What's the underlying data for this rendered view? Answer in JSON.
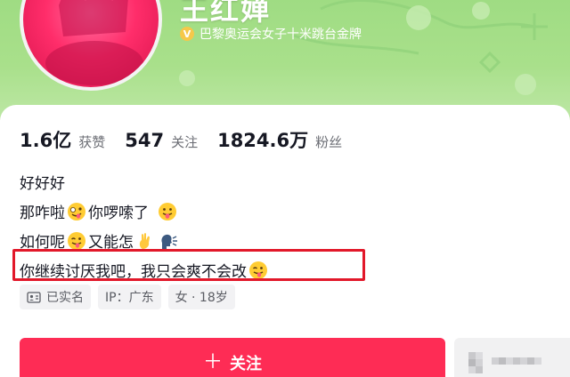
{
  "profile": {
    "name": "王红婵",
    "verification": "巴黎奥运会女子十米跳台金牌"
  },
  "stats": {
    "likes_value": "1.6亿",
    "likes_label": "获赞",
    "following_value": "547",
    "following_label": "关注",
    "followers_value": "1824.6万",
    "followers_label": "粉丝"
  },
  "bio": {
    "line1": "好好好",
    "line2_a": "那咋啦",
    "line2_b": "你啰嗦了",
    "line3_a": "如何呢",
    "line3_b": "又能怎",
    "line4": "你继续讨厌我吧，我只会爽不会改"
  },
  "tags": {
    "real_name": "已实名",
    "ip": "IP：广东",
    "gender_age": "女 · 18岁"
  },
  "actions": {
    "follow_label": "关注"
  },
  "colors": {
    "banner": "#a9e08b",
    "follow_button": "#fe2c55",
    "highlight_box": "#e2182a",
    "verify_badge": "#f5c84a"
  }
}
